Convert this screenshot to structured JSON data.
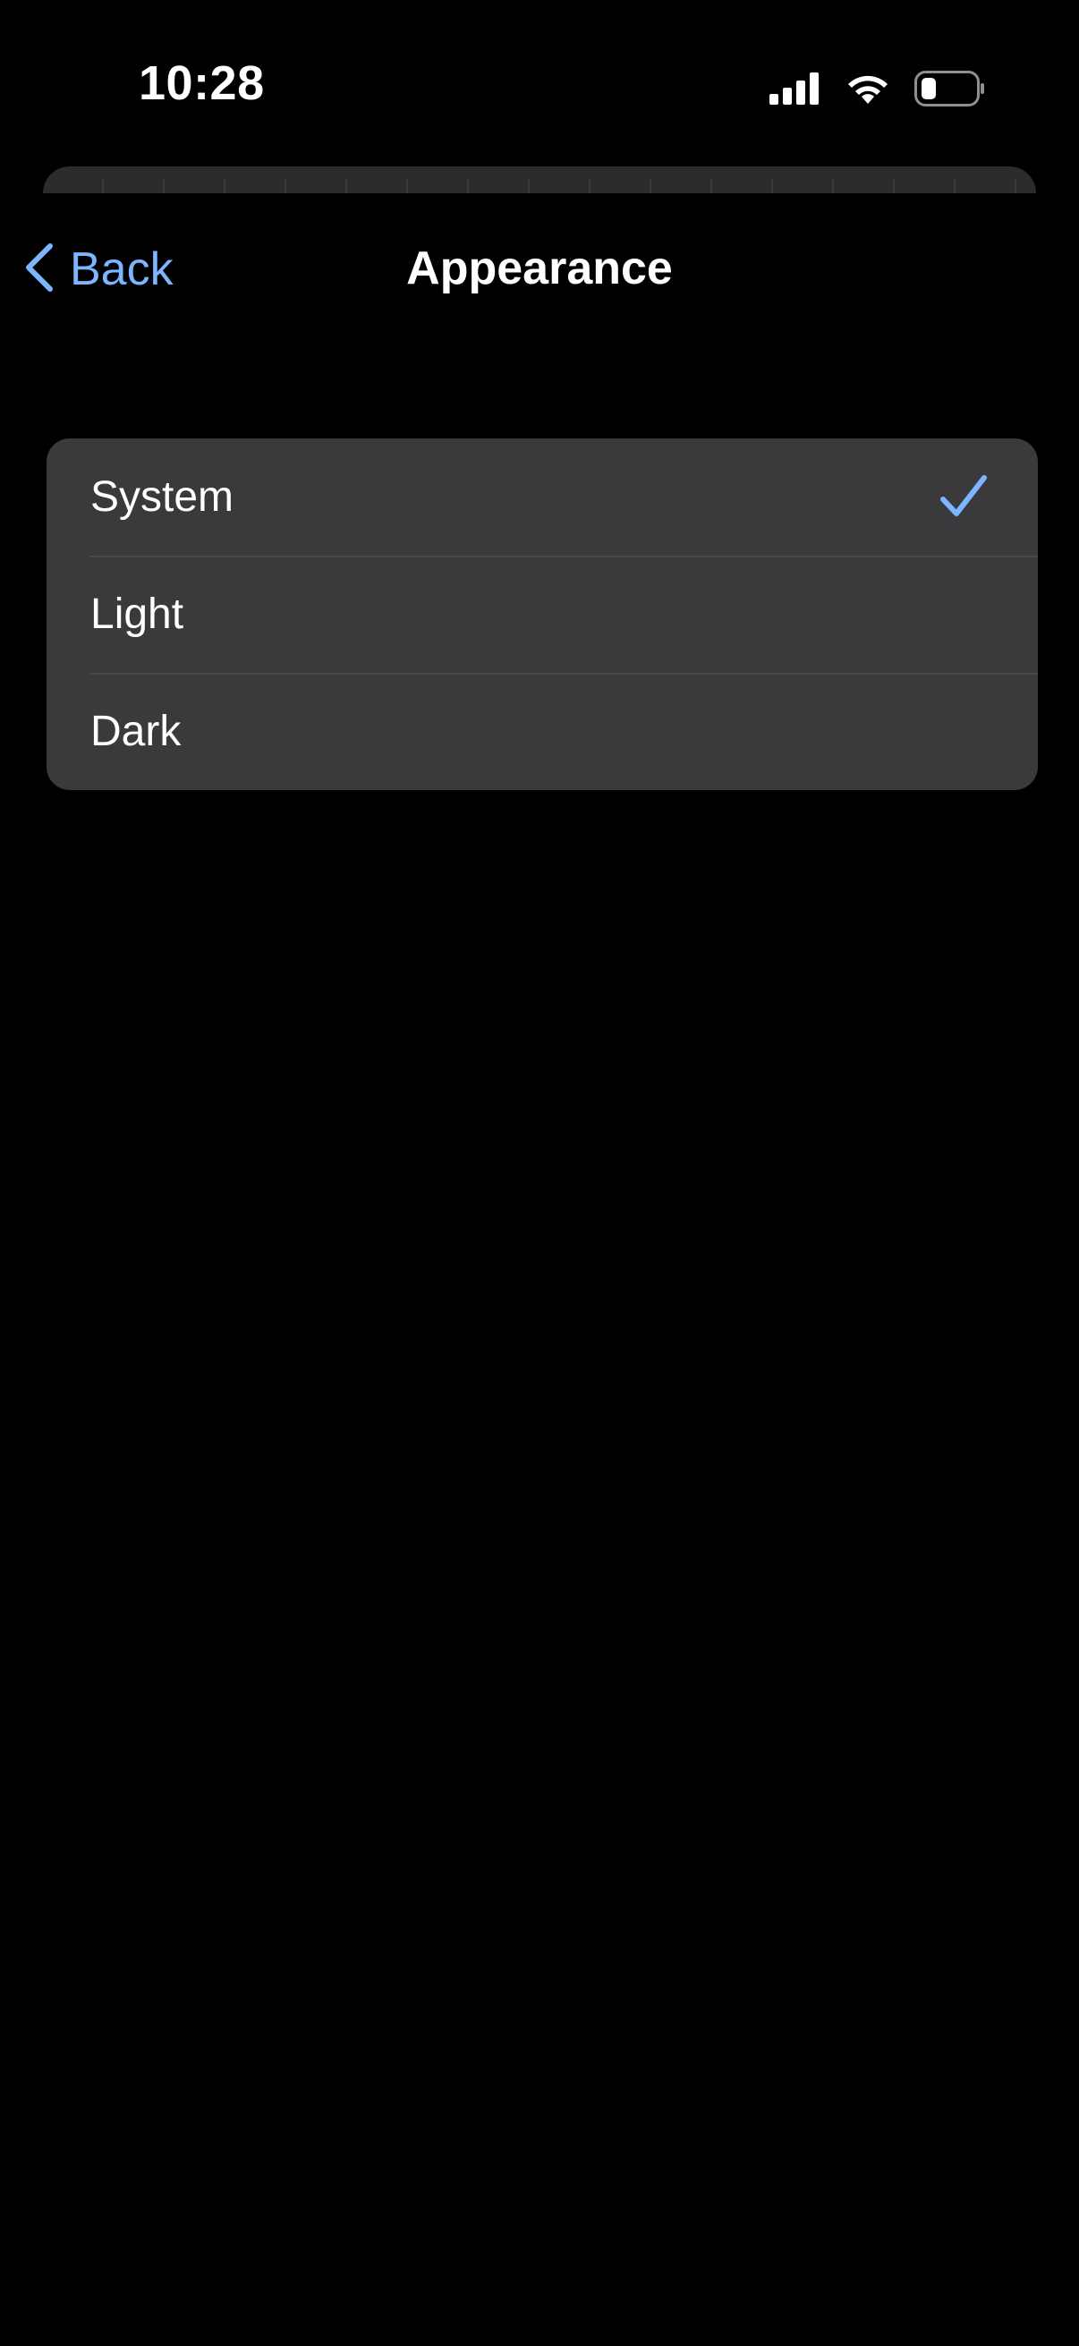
{
  "status_bar": {
    "time": "10:28"
  },
  "nav": {
    "back_label": "Back",
    "title": "Appearance"
  },
  "options": [
    {
      "label": "System",
      "selected": true
    },
    {
      "label": "Light",
      "selected": false
    },
    {
      "label": "Dark",
      "selected": false
    }
  ],
  "colors": {
    "accent": "#7db5ff",
    "background": "#000000",
    "cell": "#3a3a3c"
  },
  "icons": {
    "back": "chevron-left-icon",
    "selected": "checkmark-icon"
  }
}
